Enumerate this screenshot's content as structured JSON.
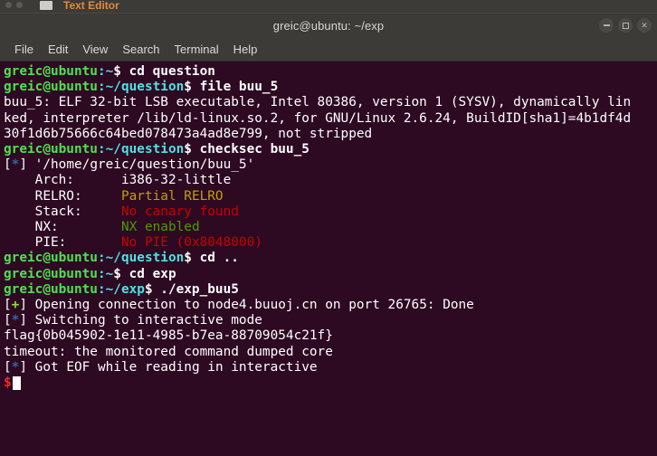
{
  "background_window": {
    "title": "Text Editor",
    "accent_color": "#e08a3c"
  },
  "window": {
    "title": "greic@ubuntu: ~/exp",
    "controls": {
      "minimize": "minimize-button",
      "maximize": "maximize-button",
      "close": "close-button"
    }
  },
  "menubar": {
    "items": [
      {
        "label": "File"
      },
      {
        "label": "Edit"
      },
      {
        "label": "View"
      },
      {
        "label": "Search"
      },
      {
        "label": "Terminal"
      },
      {
        "label": "Help"
      }
    ]
  },
  "colors": {
    "terminal_background": "#2d0922",
    "chrome_background": "#3c3b37",
    "prompt_user": "#4ee24e",
    "prompt_path": "#4ee2e2",
    "text": "#ffffff",
    "warn_yellow": "#c4a000",
    "danger_red": "#cc0000",
    "ok_green": "#4e9a06",
    "info_blue": "#3465a4",
    "cursor_prompt_red": "#ef2929"
  },
  "terminal": {
    "user": "greic",
    "host": "ubuntu",
    "lines": {
      "l01_user": "greic@ubuntu",
      "l01_path": ":~",
      "l01_cmd": "$ cd question",
      "l02_user": "greic@ubuntu",
      "l02_path": ":~/question",
      "l02_cmd": "$ file buu_5",
      "l03": "buu_5: ELF 32-bit LSB executable, Intel 80386, version 1 (SYSV), dynamically lin",
      "l04": "ked, interpreter /lib/ld-linux.so.2, for GNU/Linux 2.6.24, BuildID[sha1]=4b1df4d",
      "l05": "30f1d6b75666c64bed078473a4ad8e799, not stripped",
      "l06_user": "greic@ubuntu",
      "l06_path": ":~/question",
      "l06_cmd": "$ checksec buu_5",
      "l07_pre": "[",
      "l07_star": "*",
      "l07_post": "] '/home/greic/question/buu_5'",
      "l08_label": "    Arch:      ",
      "l08_value": "i386-32-little",
      "l09_label": "    RELRO:     ",
      "l09_value": "Partial RELRO",
      "l10_label": "    Stack:     ",
      "l10_value": "No canary found",
      "l11_label": "    NX:        ",
      "l11_value": "NX enabled",
      "l12_label": "    PIE:       ",
      "l12_value": "No PIE (0x8048000)",
      "l13_user": "greic@ubuntu",
      "l13_path": ":~/question",
      "l13_cmd": "$ cd ..",
      "l14_user": "greic@ubuntu",
      "l14_path": ":~",
      "l14_cmd": "$ cd exp",
      "l15_user": "greic@ubuntu",
      "l15_path": ":~/exp",
      "l15_cmd": "$ ./exp_buu5",
      "l16_pre": "[",
      "l16_sym": "+",
      "l16_post": "] Opening connection to node4.buuoj.cn on port 26765: Done",
      "l17_pre": "[",
      "l17_sym": "*",
      "l17_post": "] Switching to interactive mode",
      "l18": "flag{0b045902-1e11-4985-b7ea-88709054c21f}",
      "l19": "timeout: the monitored command dumped core",
      "l20_pre": "[",
      "l20_sym": "*",
      "l20_post": "] Got EOF while reading in interactive",
      "l21_prompt": "$"
    }
  }
}
